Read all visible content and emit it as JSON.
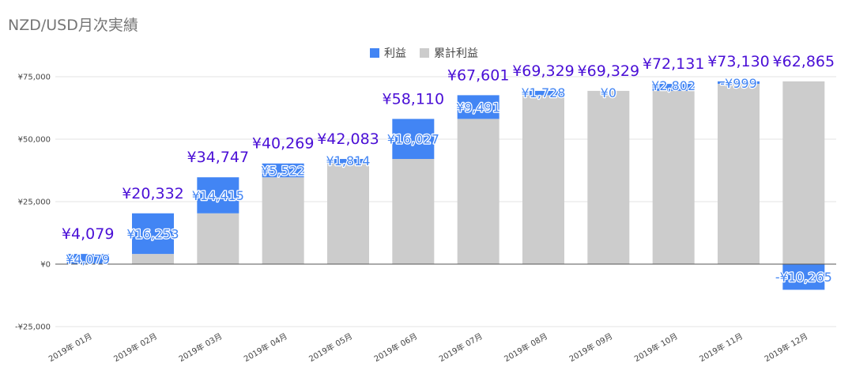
{
  "chart_data": {
    "type": "bar",
    "stacked": true,
    "title": "NZD/USD月次実績",
    "legend_position": "top",
    "grid": true,
    "ylim": [
      -25000,
      75000
    ],
    "y_ticks": [
      "¥75,000",
      "¥50,000",
      "¥25,000",
      "¥0",
      "-¥25,000"
    ],
    "y_tick_values": [
      75000,
      50000,
      25000,
      0,
      -25000
    ],
    "categories": [
      "2019年 01月",
      "2019年 02月",
      "2019年 03月",
      "2019年 04月",
      "2019年 05月",
      "2019年 06月",
      "2019年 07月",
      "2019年 08月",
      "2019年 09月",
      "2019年 10月",
      "2019年 11月",
      "2019年 12月"
    ],
    "series": [
      {
        "name": "利益",
        "color": "#4285f4",
        "values": [
          4079,
          16253,
          14415,
          5522,
          1814,
          16027,
          9491,
          1728,
          0,
          2802,
          999,
          -10265
        ],
        "labels": [
          "¥4,079",
          "¥16,253",
          "¥14,415",
          "¥5,522",
          "¥1,814",
          "¥16,027",
          "¥9,491",
          "¥1,728",
          "¥0",
          "¥2,802",
          "-¥999",
          "-¥10,265"
        ]
      },
      {
        "name": "累計利益",
        "color": "#cccccc",
        "values": [
          0,
          4079,
          20332,
          34747,
          40269,
          42083,
          58110,
          67601,
          69329,
          69329,
          72131,
          73130
        ]
      }
    ],
    "total_labels": [
      "¥4,079",
      "¥20,332",
      "¥34,747",
      "¥40,269",
      "¥42,083",
      "¥58,110",
      "¥67,601",
      "¥69,329",
      "¥69,329",
      "¥72,131",
      "¥73,130",
      "¥62,865"
    ],
    "total_values": [
      4079,
      20332,
      34747,
      40269,
      42083,
      58110,
      67601,
      69329,
      69329,
      72131,
      73130,
      62865
    ]
  }
}
